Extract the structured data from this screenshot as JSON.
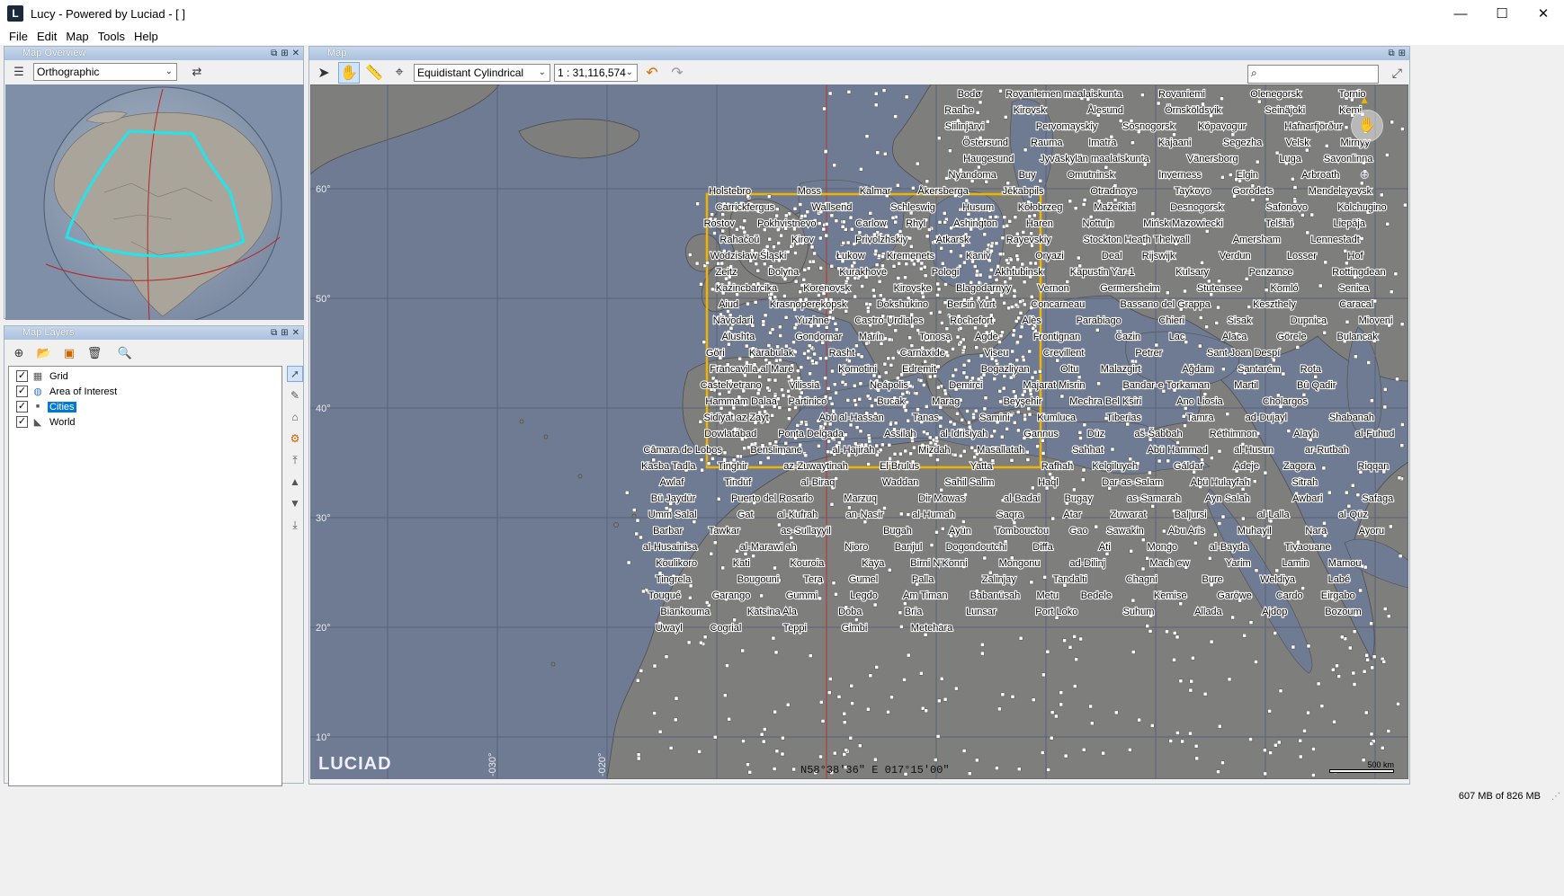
{
  "window": {
    "logo": "L",
    "title": "Lucy - Powered by Luciad - [ ]",
    "controls": {
      "minimize": "—",
      "maximize": "☐",
      "close": "✕"
    }
  },
  "menu": [
    "File",
    "Edit",
    "Map",
    "Tools",
    "Help"
  ],
  "overview": {
    "title": "Map Overview",
    "projection": "Orthographic",
    "header_buttons": [
      "⧉",
      "⊞",
      "✕"
    ]
  },
  "layers_panel": {
    "title": "Map Layers",
    "layers": [
      {
        "name": "Grid",
        "checked": true,
        "icon": "grid-icon",
        "selected": false
      },
      {
        "name": "Area of Interest",
        "checked": true,
        "icon": "globe-icon",
        "selected": false
      },
      {
        "name": "Cities",
        "checked": true,
        "icon": "point-icon",
        "selected": true
      },
      {
        "name": "World",
        "checked": true,
        "icon": "world-shape-icon",
        "selected": false
      }
    ]
  },
  "map_panel": {
    "title": "Map",
    "projection": "Equidistant Cylindrical",
    "scale": "1 : 31,116,574",
    "logo": "LUCIAD",
    "coordinates": "N58°38'36\" E 017°15'00\"",
    "scale_bar": "500 km",
    "latitude_labels": [
      "60°",
      "50°",
      "40°",
      "30°",
      "20°",
      "10°"
    ],
    "longitude_labels": [
      "-030°",
      "-020°"
    ]
  },
  "map_labels": [
    "Bodø",
    "Rovaniemen maalaiskunta",
    "Rovaniemi",
    "Olenegorsk",
    "Tornio",
    "Raahe",
    "Kirovsk",
    "Ålesund",
    "Örnsköldsvik",
    "Seinäjoki",
    "Kemi",
    "Siilinjärvi",
    "Pervomayskiy",
    "Sosnogorsk",
    "Kópavogur",
    "Hafnarfjörður",
    "Östersund",
    "Rauma",
    "Imatra",
    "Kajaani",
    "Segezha",
    "Velsk",
    "Mirnyy",
    "Haugesund",
    "Jyväskylän maalaiskunta",
    "Vänersborg",
    "Luga",
    "Savonlinna",
    "Nyandoma",
    "Buy",
    "Omutninsk",
    "Inverness",
    "Elgin",
    "Arbroath",
    "Holstebro",
    "Moss",
    "Kalmar",
    "Åkersberga",
    "Jēkabpils",
    "Otradnoye",
    "Taykovo",
    "Gorodets",
    "Mendeleyevsk",
    "Carrickfergus",
    "Wallsend",
    "Schleswig",
    "Husum",
    "Kołobrzeg",
    "Mažeikiai",
    "Desnogorsk",
    "Safonovo",
    "Kolchugino",
    "Rostov",
    "Pokhvistnevo",
    "Carlow",
    "Rhyl",
    "Ashington",
    "Haren",
    "Nottuln",
    "Mińsk Mazowiecki",
    "Telšiai",
    "Liepāja",
    "Rahačoŭ",
    "Kirov",
    "Privolzhskiy",
    "Atkarsk",
    "Rayevskiy",
    "Stockton Heath Thelwall",
    "Amersham",
    "Lennestadt",
    "Wodzisław Śląski",
    "Łukow",
    "Kremenets",
    "Kaniv",
    "Oryazi",
    "Deal",
    "Rijswijk",
    "Verdun",
    "Losser",
    "Hof",
    "Zeitz",
    "Dolyna",
    "Kurakhove",
    "Pologi",
    "Akhtubinsk",
    "Kapustin Yar-1",
    "Kulsary",
    "Penzance",
    "Rottingdean",
    "Kazincbarcika",
    "Korenovsk",
    "Kirovske",
    "Blagodarnyy",
    "Vernon",
    "Germersheim",
    "Stutensee",
    "Komló",
    "Senica",
    "Aiud",
    "Krasnoperekopsk",
    "Dokshukino",
    "Bersin Yurt",
    "Concarneau",
    "Bassano del Grappa",
    "Keszthely",
    "Caracal",
    "Návodari",
    "Yuzhne",
    "Castro-Urdiales",
    "Rochefort",
    "Alès",
    "Parabiago",
    "Chieri",
    "Sisak",
    "Dupnica",
    "Mioveni",
    "Alushta",
    "Gondomar",
    "Marín",
    "Tonosa",
    "Agde",
    "Frontignan",
    "Čazin",
    "Lac",
    "Alaca",
    "Görele",
    "Bulancak",
    "Göri",
    "Karabulak",
    "Rasht",
    "Carnaxide",
    "Viseu",
    "Crevillent",
    "Petrer",
    "Sant Joan Despí",
    "Francavilla al Mare",
    "Komotini",
    "Edremit",
    "Bogazliyan",
    "Oltu",
    "Malazgirt",
    "Ağdam",
    "Santarém",
    "Rota",
    "Castelvetrano",
    "Vilissia",
    "Neápolis",
    "Demirci",
    "Majarat Misrin",
    "Bandar-e Torkaman",
    "Martil",
    "Bû Qadir",
    "Hammam Dalaa",
    "Partinico",
    "Bucak",
    "Marag",
    "Beyşehir",
    "Mechra Bel Ksiri",
    "Ano Liosia",
    "Cholargos",
    "Sidiyat az Zayt",
    "Abû al-Hassan",
    "Tanas",
    "Samini",
    "Kumluca",
    "Tiberias",
    "Tamra",
    "ad-Dujayl",
    "Shabanah",
    "Dowlatabad",
    "Ponta Delgada",
    "Assilah",
    "al-Idrisiyah",
    "Gannus",
    "Dūz",
    "aš-Šabbah",
    "Réthimnon",
    "Alayh",
    "al-Fuhud",
    "Câmara de Lobos",
    "Benslimane",
    "al-Hajirah",
    "Mizdah",
    "Masallatah",
    "Sahhat",
    "Abū Hammad",
    "al-Husun",
    "ar-Rutbah",
    "Kasba Tadla",
    "Tinghir",
    "az-Zuwaytinah",
    "El Brulus",
    "Yatta",
    "Rafhah",
    "Kelgiluyeh",
    "Gáldar",
    "Adeje",
    "Zagora",
    "Riqqan",
    "Awlaf",
    "Tindūf",
    "al-Biraq",
    "Waddan",
    "Sahil Salim",
    "Haql",
    "Dar-as-Salam",
    "Abū Hulayfah",
    "Sitrah",
    "Bū Jaydūr",
    "Puerto del Rosario",
    "Marzuq",
    "Dir Mowas",
    "al-Badai",
    "Bugay",
    "as-Samarah",
    "Ayn Salah",
    "Awbari",
    "Safaga",
    "Umm Salal",
    "Gat",
    "al-Kufrah",
    "an-Nasir",
    "al-Humah",
    "Saqra",
    "Atar",
    "Zuwarat",
    "Baljursi",
    "al-Lalla",
    "al-Qūz",
    "Barbar",
    "Tawkar",
    "as-Sullayyil",
    "Bugah",
    "Ayūn",
    "Tombouctou",
    "Gao",
    "Sawakin",
    "Abu Aris",
    "Muhayil",
    "Nara",
    "Ayoru",
    "al-Husainisa",
    "al-Marawi ah",
    "Nioro",
    "Banjul",
    "Dogondoutchi",
    "Diffa",
    "Ati",
    "Mongo",
    "al-Bayda",
    "Tivaouane",
    "Koulikoro",
    "Kati",
    "Kouroia",
    "Kaya",
    "Birni N'Konni",
    "Mongonu",
    "ad-Dilinj",
    "Mach ew",
    "Yarim",
    "Lamin",
    "Mamou",
    "Tingrela",
    "Bougouni",
    "Tera",
    "Gumel",
    "Palla",
    "Zalinjay",
    "Tandalti",
    "Chagni",
    "Bure",
    "Weldiya",
    "Labé",
    "Tougué",
    "Garango",
    "Gummi",
    "Legdo",
    "Am Timan",
    "Babanūsah",
    "Metu",
    "Bedele",
    "Kemise",
    "Garōwe",
    "Cardo",
    "Eirgabo",
    "Biankouma",
    "Katsina Ala",
    "Doba",
    "Bria",
    "Lunsar",
    "Port Loko",
    "Suhum",
    "Allada",
    "Ajdop",
    "Bozoum",
    "Uwayl",
    "Cogrial",
    "Teppi",
    "Gimbi",
    "Metehara"
  ],
  "status": {
    "memory": "607 MB of 826 MB"
  }
}
